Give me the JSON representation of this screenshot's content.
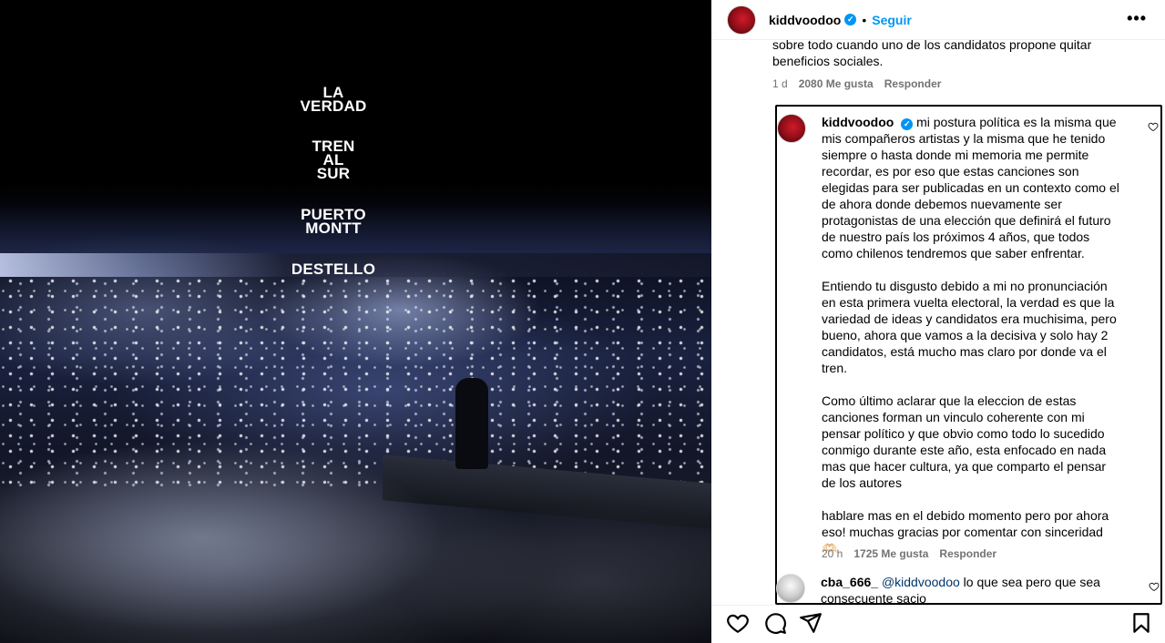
{
  "media": {
    "tracks": [
      "LA\nVERDAD",
      "TREN\nAL\nSUR",
      "PUERTO\nMONTT",
      "DESTELLO"
    ]
  },
  "header": {
    "username": "kiddvoodoo",
    "separator": "•",
    "follow_label": "Seguir",
    "more_label": "•••"
  },
  "parent_comment": {
    "text": "sobre todo cuando uno de los candidatos propone quitar beneficios sociales.",
    "time": "1 d",
    "likes": "2080 Me gusta",
    "reply_label": "Responder"
  },
  "reply_comment": {
    "username": "kiddvoodoo",
    "p1": "mi postura política es la misma que mis compañeros artistas y la misma que he tenido siempre o hasta donde mi memoria me permite recordar, es por eso que estas canciones son elegidas para ser publicadas en un contexto como el de ahora donde debemos nuevamente ser protagonistas de una elección que definirá el futuro de nuestro país los próximos 4 años, que todos como chilenos tendremos que saber enfrentar.",
    "p2": "Entiendo tu disgusto debido a mi no pronunciación en esta primera vuelta electoral, la verdad es que la variedad de ideas y candidatos era muchisima, pero bueno, ahora que vamos a la decisiva y solo hay 2 candidatos, está mucho mas claro por donde va el tren.",
    "p3": "Como último aclarar que la eleccion de estas canciones forman un vinculo coherente con mi pensar político y que obvio como todo lo sucedido conmigo durante este año, esta enfocado en nada mas que hacer cultura, ya que comparto el pensar de los autores",
    "p4": "hablare mas en el debido momento pero por ahora eso! muchas gracias por comentar con sinceridad 🫶🏻",
    "time": "20 h",
    "likes": "1725 Me gusta",
    "reply_label": "Responder"
  },
  "next_comment": {
    "username": "cba_666_",
    "mention": "@kiddvoodoo",
    "text": "lo que sea pero que sea consecuente sacio"
  },
  "icons": {
    "like": "heart-icon",
    "comment": "comment-icon",
    "share": "share-icon",
    "save": "bookmark-icon",
    "verified": "verified-badge-icon"
  }
}
